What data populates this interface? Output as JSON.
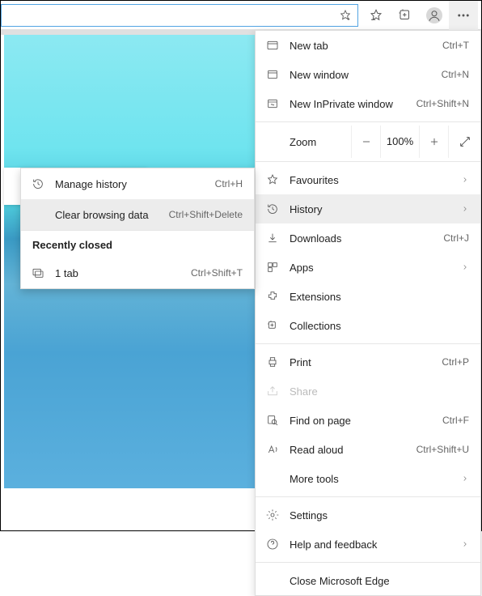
{
  "zoom": {
    "label": "Zoom",
    "value": "100%"
  },
  "menu": {
    "new_tab": {
      "label": "New tab",
      "shortcut": "Ctrl+T"
    },
    "new_window": {
      "label": "New window",
      "shortcut": "Ctrl+N"
    },
    "new_inprivate": {
      "label": "New InPrivate window",
      "shortcut": "Ctrl+Shift+N"
    },
    "favourites": {
      "label": "Favourites"
    },
    "history": {
      "label": "History"
    },
    "downloads": {
      "label": "Downloads",
      "shortcut": "Ctrl+J"
    },
    "apps": {
      "label": "Apps"
    },
    "extensions": {
      "label": "Extensions"
    },
    "collections": {
      "label": "Collections"
    },
    "print": {
      "label": "Print",
      "shortcut": "Ctrl+P"
    },
    "share": {
      "label": "Share"
    },
    "find": {
      "label": "Find on page",
      "shortcut": "Ctrl+F"
    },
    "read_aloud": {
      "label": "Read aloud",
      "shortcut": "Ctrl+Shift+U"
    },
    "more_tools": {
      "label": "More tools"
    },
    "settings": {
      "label": "Settings"
    },
    "help": {
      "label": "Help and feedback"
    },
    "close": {
      "label": "Close Microsoft Edge"
    }
  },
  "history_submenu": {
    "manage": {
      "label": "Manage history",
      "shortcut": "Ctrl+H"
    },
    "clear": {
      "label": "Clear browsing data",
      "shortcut": "Ctrl+Shift+Delete"
    },
    "recently_closed_heading": "Recently closed",
    "recent_tab": {
      "label": "1 tab",
      "shortcut": "Ctrl+Shift+T"
    }
  }
}
